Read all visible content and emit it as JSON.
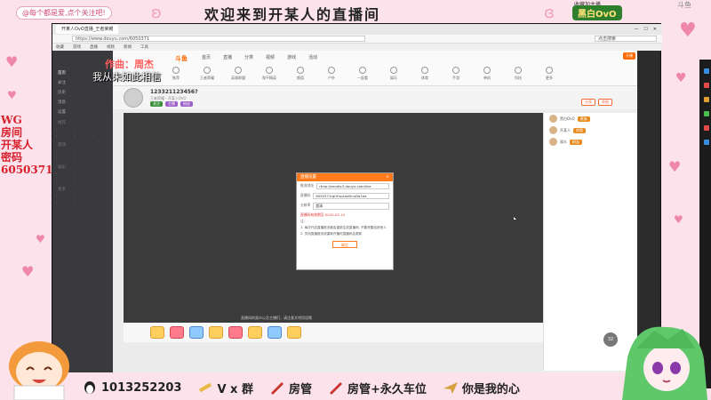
{
  "stream": {
    "top_left_label": "@每个都是爱,点个关注吧!",
    "title": "欢迎来到开某人的直播间",
    "badge_small": "收藏加主播",
    "badge": "黑白OvO",
    "watermark": "斗鱼"
  },
  "lyrics": {
    "line1": "作曲：周杰",
    "line2": "我从未如此相信"
  },
  "room_info": {
    "line1": "WG",
    "line2": "房间",
    "line3": "开某人",
    "line4": "密码",
    "line5": "6050371"
  },
  "browser": {
    "tab": "开某人OvO直播_王者荣耀",
    "url": "https://www.douyu.com/6050371",
    "search": "点击搜索",
    "bookmarks": [
      "收藏",
      "游戏",
      "直播",
      "视频",
      "新闻",
      "工具"
    ]
  },
  "site": {
    "logo": "斗鱼",
    "nav": [
      "首页",
      "直播",
      "分类",
      "视频",
      "游戏",
      "活动"
    ],
    "icons": [
      "推荐",
      "王者荣耀",
      "英雄联盟",
      "和平精英",
      "颜值",
      "户外",
      "一起看",
      "娱乐",
      "体育",
      "手游",
      "单机",
      "科技",
      "更多"
    ],
    "room_title": "123321123456?",
    "room_meta": "王者荣耀 · 开某人OvO",
    "tags": [
      "关注",
      "主播",
      "粉丝"
    ],
    "buttons": [
      "分享",
      "举报"
    ],
    "top_right": "开播",
    "player_tip": "直播间的观众以及主播们，请注意文明用语哦"
  },
  "chat": {
    "rows": [
      {
        "name": "黑白OvO",
        "badge": "贵族"
      },
      {
        "name": "开某人",
        "badge": "房管"
      },
      {
        "name": "观众",
        "badge": "粉丝"
      }
    ]
  },
  "sidebar": {
    "items": [
      "首页",
      "关注",
      "历史",
      "消息",
      "设置"
    ],
    "sections": [
      "推荐",
      "游戏",
      "娱乐",
      "更多"
    ]
  },
  "dialog": {
    "title": "直播设置",
    "field1_label": "推流地址",
    "field1_value": "rtmp://sendtc3.douyu.com/live",
    "field2_label": "直播码",
    "field2_value": "6050371rgUFxpLoxDnuDa1ea",
    "field3_label": "分辨率",
    "field3_value": "超清",
    "red_text": "直播码有效期至:2020-03-14",
    "note1": "注:",
    "note2": "1. 每次开启直播推流都会重新生成直播码, 不要泄露给其他人",
    "note3": "2. 关闭直播推流或重新开播时直播码会更新",
    "ok": "确定"
  },
  "bottom": {
    "qq": "1013252203",
    "vx": "V x 群",
    "manager": "房管",
    "manager_plus": "房管+永久车位",
    "love": "你是我的心"
  }
}
